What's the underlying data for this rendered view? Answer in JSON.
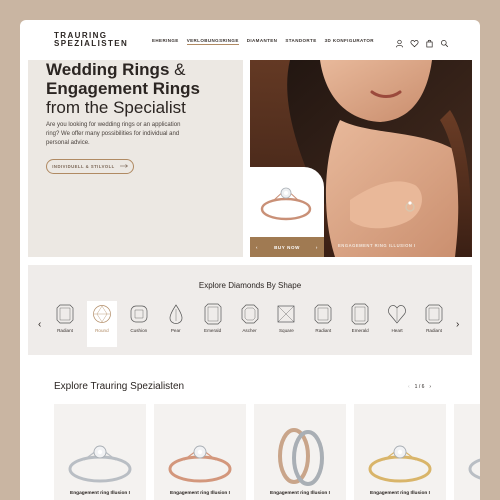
{
  "brand": {
    "line1": "TRAURING",
    "line2": "SPEZIALISTEN"
  },
  "nav": [
    "EHERINGE",
    "VERLOBUNGSRINGE",
    "DIAMANTEN",
    "STANDORTE",
    "3D KONFIGURATOR"
  ],
  "header_icons": [
    "user-icon",
    "heart-icon",
    "bag-icon",
    "search-icon"
  ],
  "hero": {
    "title_part1": "Wedding Rings",
    "title_amp": " &",
    "title_part2": "Engagement Rings",
    "title_part3": "from the Specialist",
    "text": "Are you looking for wedding rings or an application ring? We offer many possibilities for individual and personal advice.",
    "button_label": "INDIVIDUELL & STILVOLL",
    "buy_label": "BUY NOW",
    "ring_label": "ENGAGEMENT RING ILLUSION I"
  },
  "shapes": {
    "title": "Explore Diamonds By Shape",
    "items": [
      {
        "label": "Radiant",
        "shape": "radiant"
      },
      {
        "label": "Round",
        "shape": "round"
      },
      {
        "label": "Cushion",
        "shape": "cushion"
      },
      {
        "label": "Pear",
        "shape": "pear"
      },
      {
        "label": "Emerald",
        "shape": "emerald"
      },
      {
        "label": "Ascher",
        "shape": "asscher"
      },
      {
        "label": "Square",
        "shape": "square"
      },
      {
        "label": "Radiant",
        "shape": "radiant"
      },
      {
        "label": "Emerald",
        "shape": "emerald"
      },
      {
        "label": "Heart",
        "shape": "heart"
      },
      {
        "label": "Radiant",
        "shape": "radiant"
      }
    ],
    "selected_index": 1
  },
  "explore": {
    "title": "Explore Trauring Spezialisten",
    "pager": "1 / 6",
    "products": [
      {
        "name": "Engagement ring Illusion I",
        "metal": "white"
      },
      {
        "name": "Engagement ring Illusion I",
        "metal": "rose"
      },
      {
        "name": "Engagement ring Illusion I",
        "metal": "bands"
      },
      {
        "name": "Engagement ring Illusion I",
        "metal": "gold"
      },
      {
        "name": "",
        "metal": "white"
      }
    ]
  },
  "colors": {
    "accent": "#b08a63",
    "buy_bar": "#a07a52",
    "background": "#c9b5a2"
  }
}
